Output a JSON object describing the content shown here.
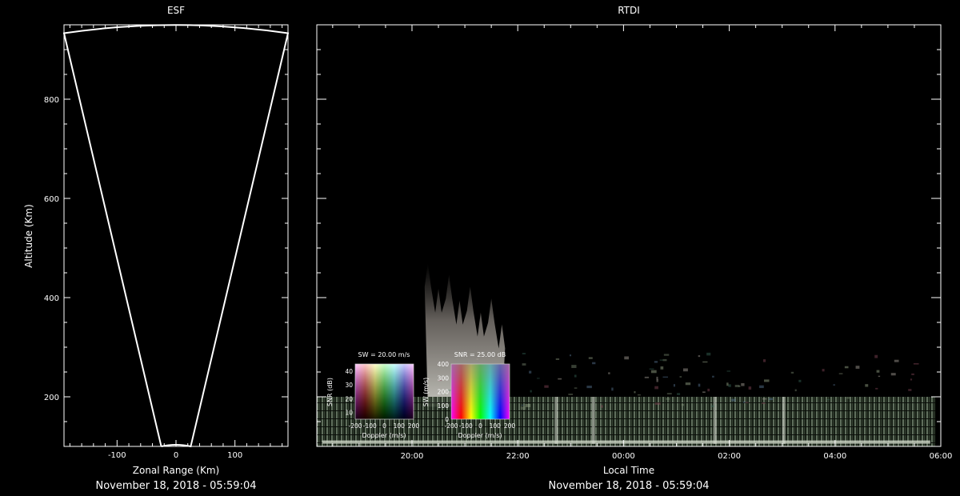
{
  "colors": {
    "background": "#000000",
    "foreground": "#ffffff",
    "legend_frame": "#cccccc"
  },
  "chart_data": [
    {
      "type": "scatter",
      "title": "ESF",
      "xlabel": "Zonal Range (Km)",
      "ylabel": "Altitude (Km)",
      "xlim": [
        -190,
        190
      ],
      "ylim": [
        100,
        950
      ],
      "xticks": [
        -100,
        0,
        100
      ],
      "yticks": [
        200,
        400,
        600,
        800
      ],
      "footer": "November 18, 2018 - 05:59:04",
      "beam_outline": {
        "left_edge": [
          [
            -25,
            100
          ],
          [
            -190,
            933
          ]
        ],
        "right_edge": [
          [
            25,
            100
          ],
          [
            190,
            933
          ]
        ],
        "arc_apex_altitude": 950
      },
      "grid": false
    },
    {
      "type": "heatmap",
      "title": "RTDI",
      "xlabel": "Local Time",
      "xticks": [
        "20:00",
        "22:00",
        "00:00",
        "02:00",
        "04:00",
        "06:00"
      ],
      "x_hours": [
        18.2,
        30.0
      ],
      "ylim": [
        100,
        950
      ],
      "footer": "November 18, 2018 - 05:59:04",
      "plume": {
        "start_hour": 20.3,
        "end_hour": 21.7,
        "top_altitude": 470
      },
      "bottomside_layer": {
        "start_hour": 18.2,
        "end_hour": 29.9,
        "altitude_range": [
          100,
          200
        ]
      },
      "legends": [
        {
          "title": "SW = 20.00 m/s",
          "xlabel": "Doppler (m/s)",
          "ylabel": "SNR (dB)",
          "xticks": [
            "-200",
            "-100",
            "0",
            "100",
            "200"
          ],
          "yticks": [
            "10",
            "20",
            "30",
            "40"
          ]
        },
        {
          "title": "SNR = 25.00 dB",
          "xlabel": "Doppler (m/s)",
          "ylabel": "SW (m/s)",
          "xticks": [
            "-200",
            "-100",
            "0",
            "100",
            "200"
          ],
          "yticks": [
            "0",
            "100",
            "200",
            "300",
            "400"
          ]
        }
      ]
    }
  ]
}
